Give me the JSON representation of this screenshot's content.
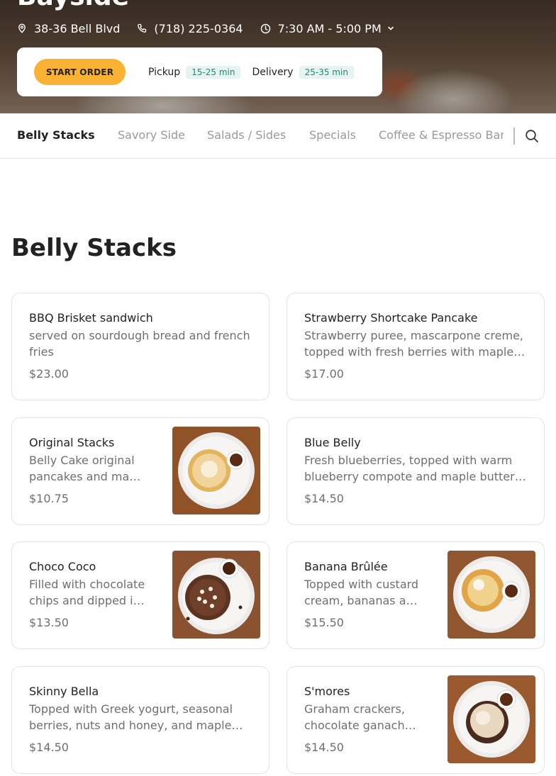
{
  "store": {
    "name": "Bayside",
    "address": "38-36 Bell Blvd",
    "phone": "(718) 225-0364",
    "hours": "7:30 AM - 5:00 PM"
  },
  "order": {
    "start_label": "START ORDER",
    "pickup_label": "Pickup",
    "pickup_eta": "15-25 min",
    "delivery_label": "Delivery",
    "delivery_eta": "25-35 min"
  },
  "tabs": [
    "Belly Stacks",
    "Savory Side",
    "Salads / Sides",
    "Specials",
    "Coffee & Espresso Bar"
  ],
  "section": {
    "title": "Belly Stacks"
  },
  "items": [
    {
      "name": "BBQ Brisket sandwich",
      "description": "served on sourdough bread and french fries",
      "price": "$23.00"
    },
    {
      "name": "Strawberry Shortcake Pancake",
      "description": "Strawberry puree, mascarpone creme, topped with fresh berries with maple…",
      "price": "$17.00"
    },
    {
      "name": "Original Stacks",
      "description": "Belly Cake original pancakes and ma…",
      "price": "$10.75"
    },
    {
      "name": "Blue Belly",
      "description": "Fresh blueberries, topped with warm blueberry compote and maple butter…",
      "price": "$14.50"
    },
    {
      "name": "Choco Coco",
      "description": "Filled with chocolate chips and dipped i…",
      "price": "$13.50"
    },
    {
      "name": "Banana Brûlée",
      "description": "Topped with custard cream, bananas a…",
      "price": "$15.50"
    },
    {
      "name": "Skinny Bella",
      "description": "Topped with Greek yogurt, seasonal berries, nuts and honey, and maple…",
      "price": "$14.50"
    },
    {
      "name": "S'mores",
      "description": "Graham crackers, chocolate ganach…",
      "price": "$14.50"
    }
  ],
  "icons": {
    "address": "map-pin-icon",
    "phone": "phone-icon",
    "hours": "clock-icon",
    "hours_toggle": "chevron-down-icon",
    "search": "search-icon"
  },
  "colors": {
    "accent": "#f9b233",
    "eta_bg": "#e6f4f1",
    "eta_text": "#1f8a73"
  }
}
